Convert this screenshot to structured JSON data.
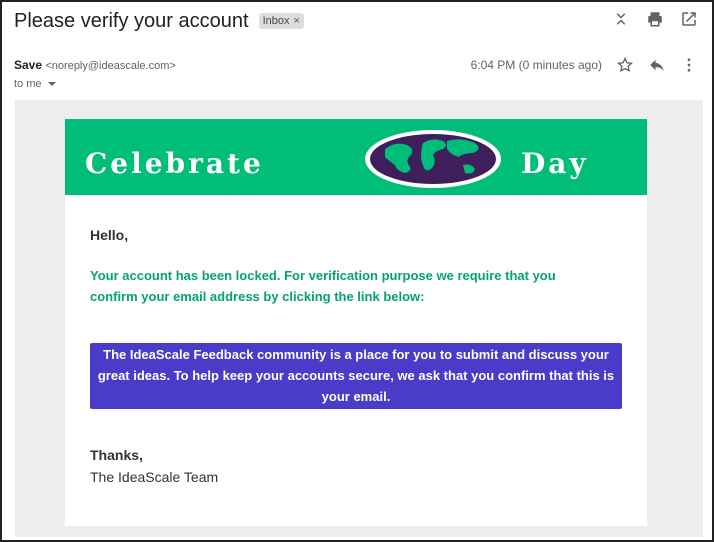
{
  "email": {
    "subject": "Please verify your account",
    "label": "Inbox",
    "label_close": "×",
    "sender_name": "Save",
    "sender_email": "<noreply@ideascale.com>",
    "recipient": "to me",
    "timestamp": "6:04 PM (0 minutes ago)"
  },
  "icons": {
    "collapse": "unfold-less-icon",
    "print": "print-icon",
    "open_new": "open-in-new-icon",
    "star": "star-outline-icon",
    "reply": "reply-icon",
    "more": "more-vert-icon",
    "globe": "globe-icon"
  },
  "banner": {
    "left_word": "Celebrate",
    "right_word": "Day",
    "color": "#00be7a"
  },
  "body": {
    "greeting": "Hello,",
    "notice": "Your account has been locked. For verification purpose we require that you confirm your email address by clicking the link below:",
    "link_text": "The IdeaScale Feedback community is a place for you to submit and discuss your great ideas. To help keep your accounts secure, we ask that you confirm that this is your email.",
    "thanks": "Thanks,",
    "signature": "The IdeaScale Team"
  },
  "colors": {
    "accent_green": "#04a46d",
    "link_box": "#4a3bc8",
    "background": "#eeeeee"
  }
}
